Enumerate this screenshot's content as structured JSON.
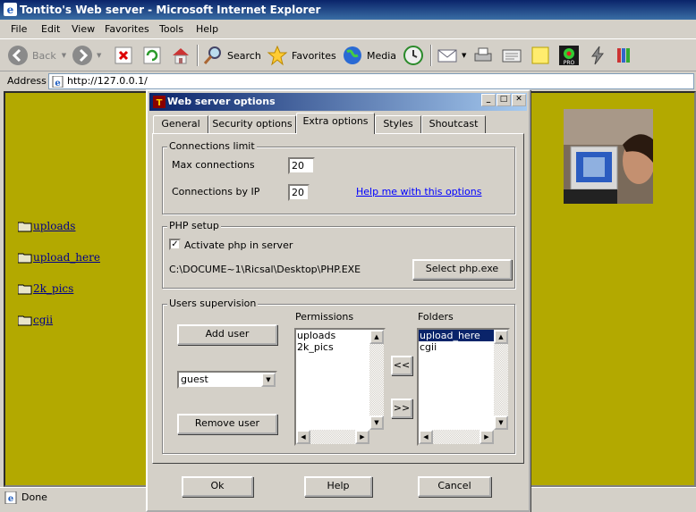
{
  "browser": {
    "title": "Tontito's Web server - Microsoft Internet Explorer",
    "menu": [
      "File",
      "Edit",
      "View",
      "Favorites",
      "Tools",
      "Help"
    ],
    "toolbar": {
      "back": "Back",
      "search": "Search",
      "favorites": "Favorites",
      "media": "Media"
    },
    "address_label": "Address",
    "address_value": "http://127.0.0.1/",
    "status": "Done"
  },
  "page": {
    "background": "#b3a900",
    "links": [
      "uploads",
      "upload_here",
      "2k_pics",
      "cgii"
    ]
  },
  "dialog": {
    "title": "Web server options",
    "tabs": [
      "General",
      "Security options",
      "Extra options",
      "Styles",
      "Shoutcast"
    ],
    "active_tab": "Extra options",
    "connections": {
      "group_label": "Connections limit",
      "max_label": "Max connections",
      "max_value": "20",
      "byip_label": "Connections by IP",
      "byip_value": "20",
      "help_link": "Help me with this options"
    },
    "php": {
      "group_label": "PHP setup",
      "activate_label": "Activate php in server",
      "activate_checked": true,
      "path": "C:\\DOCUME~1\\Ricsal\\Desktop\\PHP.EXE",
      "select_button": "Select php.exe"
    },
    "users": {
      "group_label": "Users supervision",
      "add_user": "Add user",
      "user_select": "guest",
      "remove_user": "Remove user",
      "permissions_label": "Permissions",
      "permissions": [
        "uploads",
        "2k_pics"
      ],
      "folders_label": "Folders",
      "folders": [
        "upload_here",
        "cgii"
      ],
      "selected_folder": "upload_here",
      "move_left": "<<",
      "move_right": ">>"
    },
    "buttons": {
      "ok": "Ok",
      "help": "Help",
      "cancel": "Cancel"
    }
  }
}
